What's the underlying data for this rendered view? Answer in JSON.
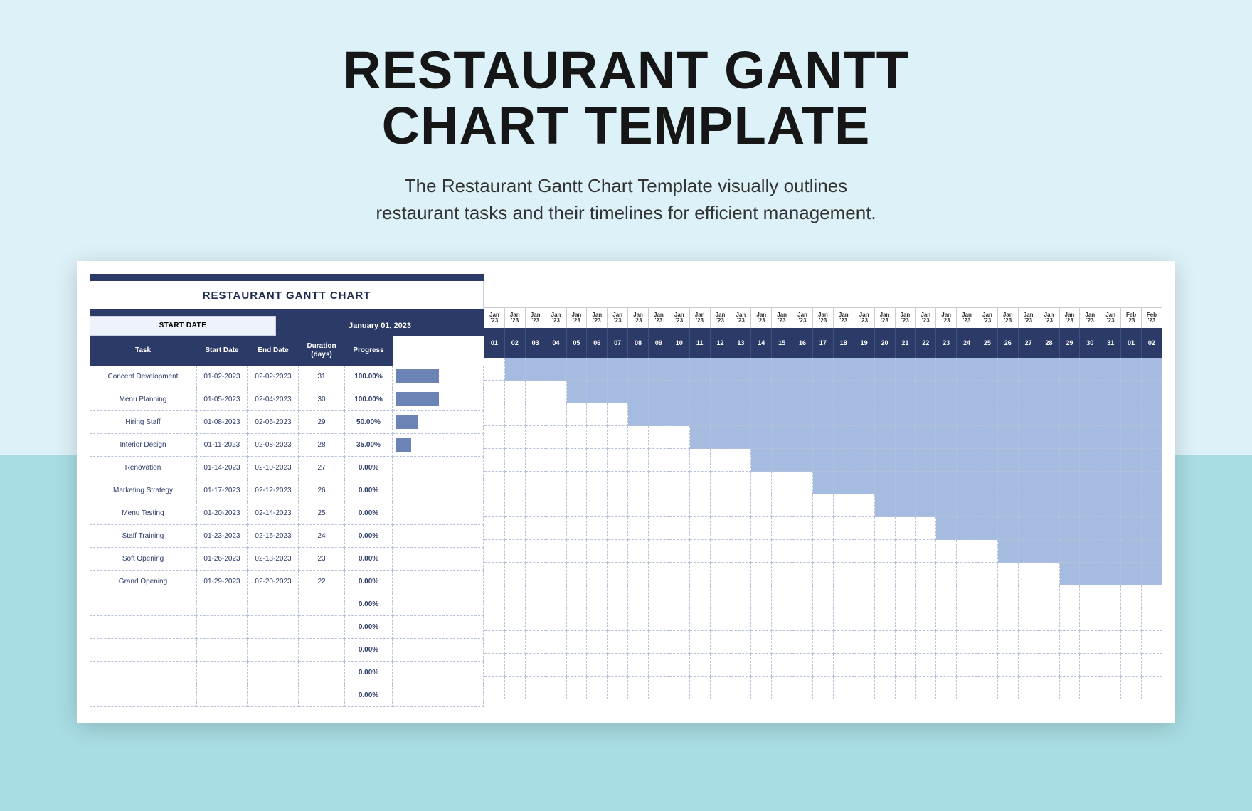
{
  "header": {
    "title_line1": "RESTAURANT GANTT",
    "title_line2": "CHART TEMPLATE",
    "subtitle_line1": "The Restaurant Gantt Chart Template visually outlines",
    "subtitle_line2": "restaurant tasks and their timelines for efficient management."
  },
  "sheet": {
    "chart_title": "RESTAURANT GANTT CHART",
    "start_date_label": "START DATE",
    "start_date_value": "January 01, 2023",
    "columns": {
      "task": "Task",
      "start": "Start Date",
      "end": "End Date",
      "duration": "Duration\n(days)",
      "progress": "Progress"
    }
  },
  "chart_data": {
    "type": "gantt",
    "timeline": {
      "start": "2023-01-01",
      "end": "2023-02-02",
      "days": [
        "01",
        "02",
        "03",
        "04",
        "05",
        "06",
        "07",
        "08",
        "09",
        "10",
        "11",
        "12",
        "13",
        "14",
        "15",
        "16",
        "17",
        "18",
        "19",
        "20",
        "21",
        "22",
        "23",
        "24",
        "25",
        "26",
        "27",
        "28",
        "29",
        "30",
        "31",
        "01",
        "02"
      ],
      "month_labels": [
        "Jan '23",
        "Jan '23",
        "Jan '23",
        "Jan '23",
        "Jan '23",
        "Jan '23",
        "Jan '23",
        "Jan '23",
        "Jan '23",
        "Jan '23",
        "Jan '23",
        "Jan '23",
        "Jan '23",
        "Jan '23",
        "Jan '23",
        "Jan '23",
        "Jan '23",
        "Jan '23",
        "Jan '23",
        "Jan '23",
        "Jan '23",
        "Jan '23",
        "Jan '23",
        "Jan '23",
        "Jan '23",
        "Jan '23",
        "Jan '23",
        "Jan '23",
        "Jan '23",
        "Jan '23",
        "Jan '23",
        "Feb '23",
        "Feb '23"
      ]
    },
    "tasks": [
      {
        "name": "Concept Development",
        "start": "01-02-2023",
        "end": "02-02-2023",
        "duration": "31",
        "progress": "100.00%",
        "bar_pct": 100,
        "gantt_start": 1,
        "gantt_end": 33
      },
      {
        "name": "Menu Planning",
        "start": "01-05-2023",
        "end": "02-04-2023",
        "duration": "30",
        "progress": "100.00%",
        "bar_pct": 100,
        "gantt_start": 4,
        "gantt_end": 33
      },
      {
        "name": "Hiring Staff",
        "start": "01-08-2023",
        "end": "02-06-2023",
        "duration": "29",
        "progress": "50.00%",
        "bar_pct": 50,
        "gantt_start": 7,
        "gantt_end": 33
      },
      {
        "name": "Interior Design",
        "start": "01-11-2023",
        "end": "02-08-2023",
        "duration": "28",
        "progress": "35.00%",
        "bar_pct": 35,
        "gantt_start": 10,
        "gantt_end": 33
      },
      {
        "name": "Renovation",
        "start": "01-14-2023",
        "end": "02-10-2023",
        "duration": "27",
        "progress": "0.00%",
        "bar_pct": 0,
        "gantt_start": 13,
        "gantt_end": 33
      },
      {
        "name": "Marketing Strategy",
        "start": "01-17-2023",
        "end": "02-12-2023",
        "duration": "26",
        "progress": "0.00%",
        "bar_pct": 0,
        "gantt_start": 16,
        "gantt_end": 33
      },
      {
        "name": "Menu Testing",
        "start": "01-20-2023",
        "end": "02-14-2023",
        "duration": "25",
        "progress": "0.00%",
        "bar_pct": 0,
        "gantt_start": 19,
        "gantt_end": 33
      },
      {
        "name": "Staff Training",
        "start": "01-23-2023",
        "end": "02-16-2023",
        "duration": "24",
        "progress": "0.00%",
        "bar_pct": 0,
        "gantt_start": 22,
        "gantt_end": 33
      },
      {
        "name": "Soft Opening",
        "start": "01-26-2023",
        "end": "02-18-2023",
        "duration": "23",
        "progress": "0.00%",
        "bar_pct": 0,
        "gantt_start": 25,
        "gantt_end": 33
      },
      {
        "name": "Grand Opening",
        "start": "01-29-2023",
        "end": "02-20-2023",
        "duration": "22",
        "progress": "0.00%",
        "bar_pct": 0,
        "gantt_start": 28,
        "gantt_end": 33
      },
      {
        "name": "",
        "start": "",
        "end": "",
        "duration": "",
        "progress": "0.00%",
        "bar_pct": 0,
        "gantt_start": -1,
        "gantt_end": -1
      },
      {
        "name": "",
        "start": "",
        "end": "",
        "duration": "",
        "progress": "0.00%",
        "bar_pct": 0,
        "gantt_start": -1,
        "gantt_end": -1
      },
      {
        "name": "",
        "start": "",
        "end": "",
        "duration": "",
        "progress": "0.00%",
        "bar_pct": 0,
        "gantt_start": -1,
        "gantt_end": -1
      },
      {
        "name": "",
        "start": "",
        "end": "",
        "duration": "",
        "progress": "0.00%",
        "bar_pct": 0,
        "gantt_start": -1,
        "gantt_end": -1
      },
      {
        "name": "",
        "start": "",
        "end": "",
        "duration": "",
        "progress": "0.00%",
        "bar_pct": 0,
        "gantt_start": -1,
        "gantt_end": -1
      }
    ]
  }
}
